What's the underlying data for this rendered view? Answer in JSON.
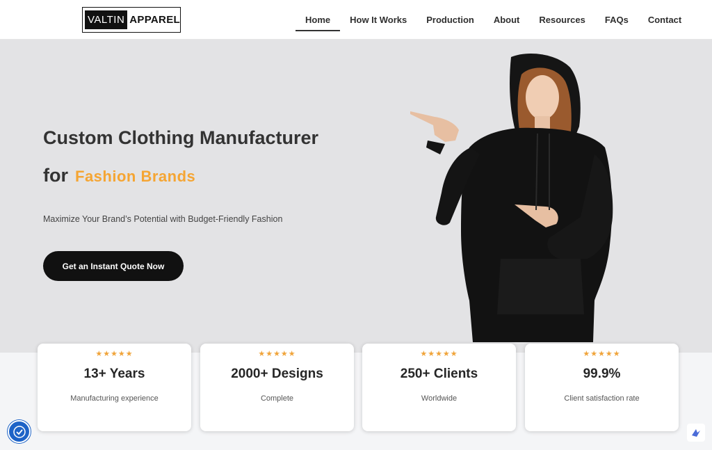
{
  "brand": {
    "logo_left": "VALTIN",
    "logo_right": "APPAREL"
  },
  "nav": {
    "items": [
      {
        "label": "Home",
        "active": true
      },
      {
        "label": "How It Works"
      },
      {
        "label": "Production"
      },
      {
        "label": "About"
      },
      {
        "label": "Resources"
      },
      {
        "label": "FAQs"
      },
      {
        "label": "Contact"
      }
    ]
  },
  "hero": {
    "headline_line1": "Custom Clothing Manufacturer",
    "headline_for": "for",
    "headline_accent": "Fashion Brands",
    "subheadline": "Maximize Your Brand’s Potential with Budget-Friendly Fashion",
    "cta_label": "Get an Instant Quote Now",
    "accent_color": "#f5a533"
  },
  "stats": [
    {
      "stars": "★★★★★",
      "value": "13+ Years",
      "label": "Manufacturing experience"
    },
    {
      "stars": "★★★★★",
      "value": "2000+ Designs",
      "label": "Complete"
    },
    {
      "stars": "★★★★★",
      "value": "250+ Clients",
      "label": "Worldwide"
    },
    {
      "stars": "★★★★★",
      "value": "99.9%",
      "label": "Client satisfaction rate"
    }
  ],
  "widgets": {
    "accessibility_icon": "accessibility-icon",
    "assistant_icon": "assistant-icon"
  }
}
